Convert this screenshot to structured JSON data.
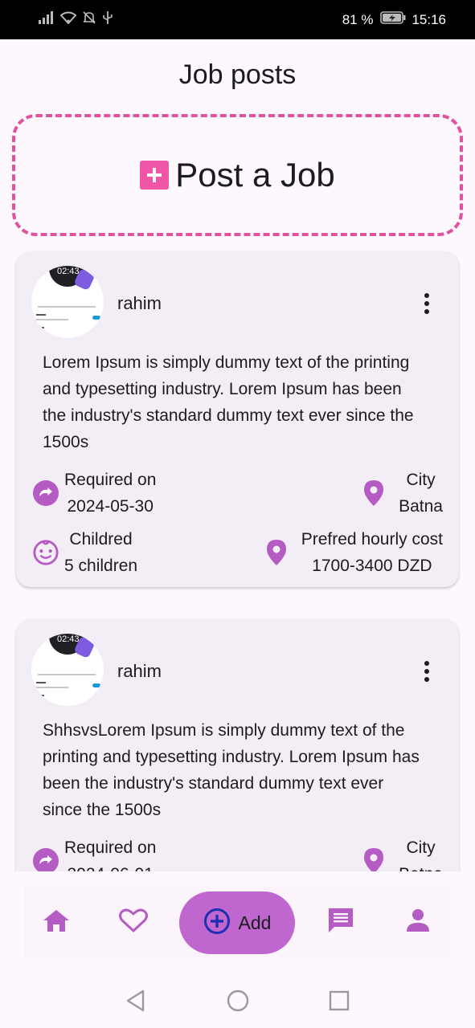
{
  "status_bar": {
    "battery_percent": "81 %",
    "time": "15:16",
    "icons": [
      "signal-icon",
      "wifi-icon",
      "notifications-off-icon",
      "usb-icon",
      "battery-charging-icon"
    ]
  },
  "page": {
    "title": "Job posts"
  },
  "post_job": {
    "label": "Post a Job",
    "icon": "plus-square-icon"
  },
  "posts": [
    {
      "avatar_time": "02:43",
      "username": "rahim",
      "description": "Lorem Ipsum is simply dummy text of the printing and typesetting industry. Lorem Ipsum has been the industry's standard dummy text ever since the 1500s",
      "required_label": "Required on",
      "required_date": "2024-05-30",
      "city_label": "City",
      "city": "Batna",
      "children_label": "Childred",
      "children": "5 children",
      "cost_label": "Prefred hourly cost",
      "cost": "1700-3400 DZD"
    },
    {
      "avatar_time": "02:43",
      "username": "rahim",
      "description": "ShhsvsLorem Ipsum is simply dummy text of the printing and typesetting industry. Lorem Ipsum has been the industry's standard dummy text ever since the 1500s",
      "required_label": "Required on",
      "required_date": "2024-06-01",
      "city_label": "City",
      "city": "Batna"
    }
  ],
  "bottom_nav": {
    "add_label": "Add",
    "items": [
      "home-icon",
      "favorite-icon",
      "add-circle-icon",
      "chat-icon",
      "person-icon"
    ]
  },
  "colors": {
    "accent": "#c066cf",
    "icon_purple": "#b45bc4",
    "dashed_border": "#e0529f",
    "plus_pink": "#f056a8",
    "card_bg": "#f3eef6",
    "page_bg": "#fdf8fd"
  }
}
